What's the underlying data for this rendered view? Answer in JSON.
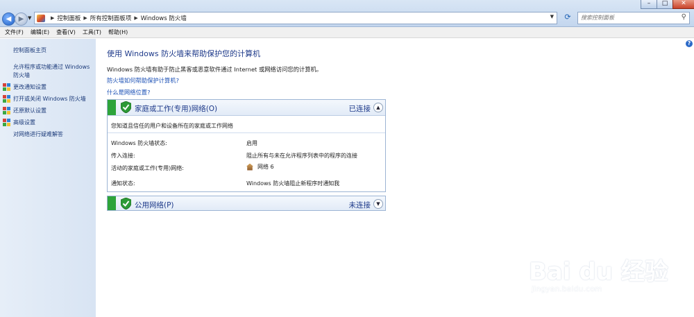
{
  "address": {
    "crumbs": [
      "控制面板",
      "所有控制面板项",
      "Windows 防火墙"
    ]
  },
  "search": {
    "placeholder": "搜索控制面板"
  },
  "menu": [
    "文件(F)",
    "编辑(E)",
    "查看(V)",
    "工具(T)",
    "帮助(H)"
  ],
  "sidebar": {
    "home": "控制面板主页",
    "allow": "允许程序或功能通过 Windows 防火墙",
    "items": [
      "更改通知设置",
      "打开或关闭 Windows 防火墙",
      "还原默认设置",
      "高级设置"
    ],
    "troubleshoot": "对网络进行疑难解答"
  },
  "main": {
    "title": "使用 Windows 防火墙来帮助保护您的计算机",
    "description": "Windows 防火墙有助于防止黑客或恶意软件通过 Internet 或网络访问您的计算机。",
    "link1": "防火墙如何帮助保护计算机?",
    "link2": "什么是网络位置?"
  },
  "home_network": {
    "title": "家庭或工作(专用)网络(O)",
    "status": "已连接",
    "subtitle": "您知道且信任的用户和设备所在的家庭或工作网络",
    "rows": [
      {
        "label": "Windows 防火墙状态:",
        "value": "启用"
      },
      {
        "label": "传入连接:",
        "value": "阻止所有与未在允许程序列表中的程序的连接"
      },
      {
        "label": "活动的家庭或工作(专用)网络:",
        "value": "网络  6"
      },
      {
        "label": "通知状态:",
        "value": "Windows 防火墙阻止新程序时通知我"
      }
    ]
  },
  "public_network": {
    "title": "公用网络(P)",
    "status": "未连接"
  },
  "watermark": {
    "brand": "Bai du 经验",
    "url": "jingyan.baidu.com"
  },
  "colors": {
    "accent_green": "#2ea43a",
    "link_blue": "#1a4fb5",
    "title_blue": "#1e3a8a"
  }
}
